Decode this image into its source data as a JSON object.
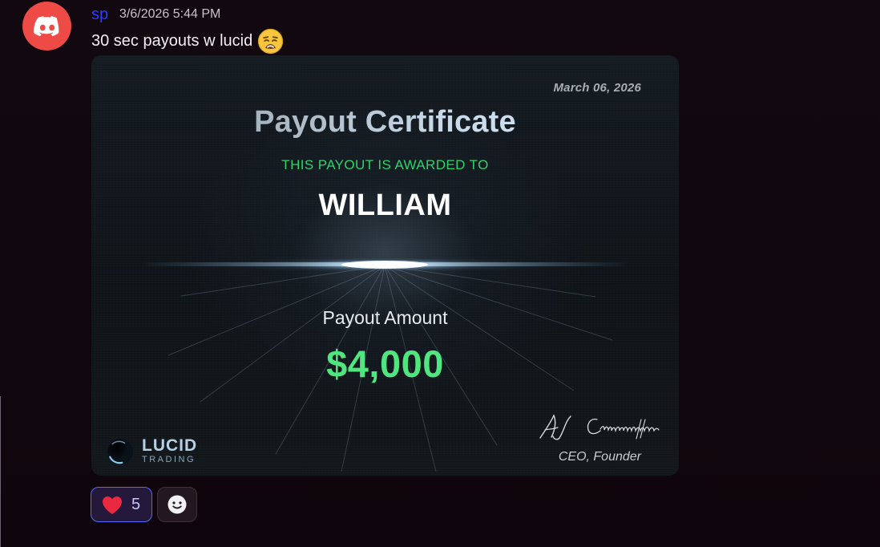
{
  "message": {
    "author": "sp",
    "timestamp": "3/6/2026 5:44 PM",
    "text": "30 sec payouts w lucid",
    "emoji_icon": "weary-face-emoji"
  },
  "certificate": {
    "date": "March 06, 2026",
    "title": "Payout Certificate",
    "awarded_text": "THIS PAYOUT IS AWARDED TO",
    "recipient": "WILLIAM",
    "amount_label": "Payout Amount",
    "amount": "$4,000",
    "logo_primary": "LUCID",
    "logo_secondary": "TRADING",
    "signature_text": "AJ Campanella",
    "signer_role": "CEO, Founder"
  },
  "reactions": [
    {
      "icon": "heart-icon",
      "count": "5"
    },
    {
      "icon": "add-reaction-icon"
    }
  ],
  "colors": {
    "avatar": "#ee4b46",
    "username": "#2d3cff",
    "awarded_text": "#2ed26b",
    "amount": "#4fe680",
    "reaction_border": "#5a67ff"
  }
}
